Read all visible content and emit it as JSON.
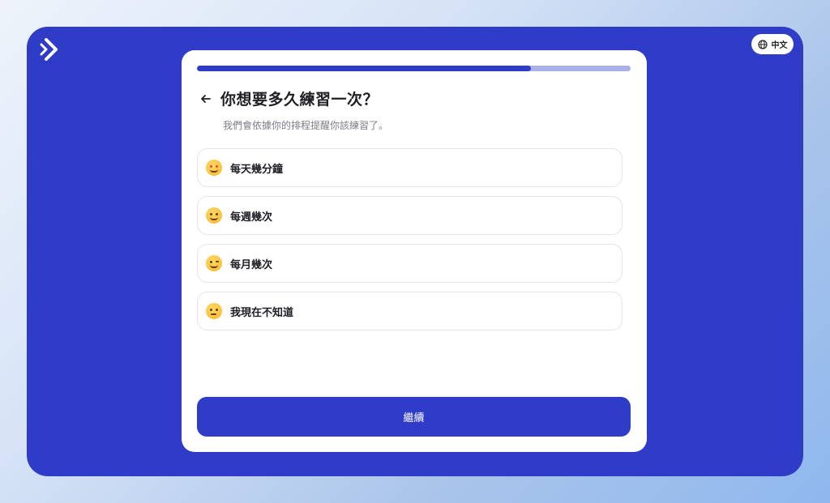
{
  "brand": {
    "logo_icon": "double-chevron-right-icon"
  },
  "language": {
    "label": "中文",
    "icon": "globe-icon"
  },
  "progress": {
    "fraction": 0.77
  },
  "question": {
    "title": "你想要多久練習一次？",
    "subtitle": "我們會依據你的排程提醒你該練習了。"
  },
  "options": [
    {
      "label": "每天幾分鐘",
      "icon": "star-struck-emoji"
    },
    {
      "label": "每週幾次",
      "icon": "smiling-blushing-emoji"
    },
    {
      "label": "每月幾次",
      "icon": "winking-emoji"
    },
    {
      "label": "我現在不知道",
      "icon": "thinking-emoji"
    }
  ],
  "actions": {
    "continue_label": "繼續"
  },
  "colors": {
    "accent": "#2f3cc7",
    "progress_track": "#aab0e8"
  }
}
